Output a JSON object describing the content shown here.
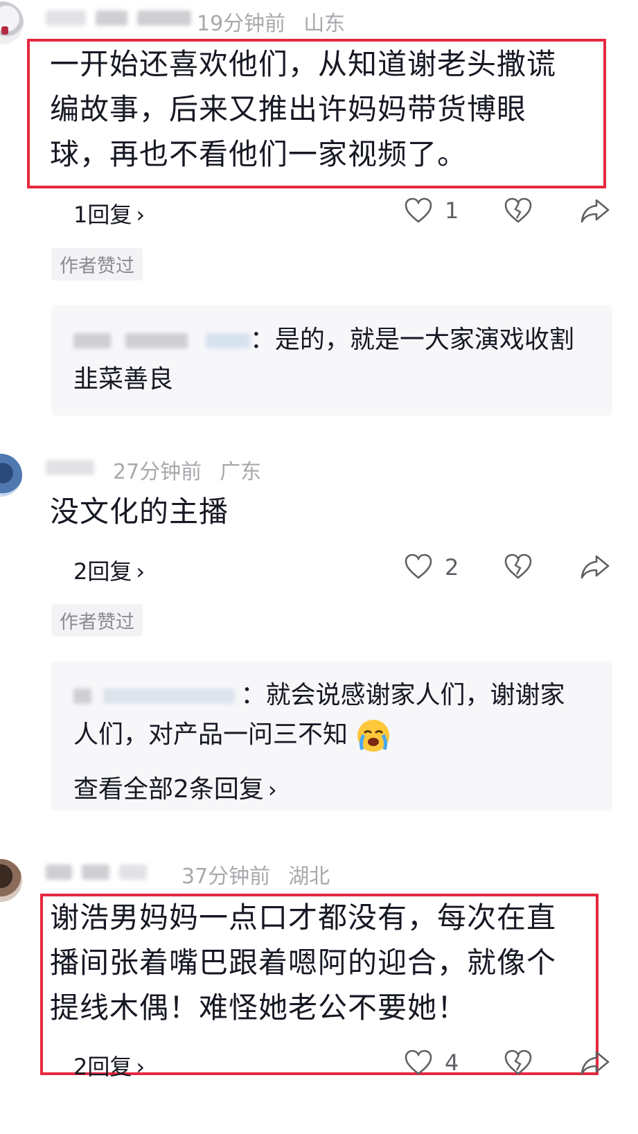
{
  "comments": [
    {
      "time": "19分钟前",
      "location": "山东",
      "text_lines": [
        "一开始还喜欢他们，从知道谢老头撒谎",
        "编故事，后来又推出许妈妈带货博眼",
        "球，再也不看他们一家视频了。"
      ],
      "replies_label": "1回复",
      "likes": "1",
      "author_liked": "作者赞过",
      "reply_text_lines": [
        "：是的，就是一大家演戏收割",
        "韭菜善良"
      ]
    },
    {
      "time": "27分钟前",
      "location": "广东",
      "text_lines": [
        "没文化的主播"
      ],
      "replies_label": "2回复",
      "likes": "2",
      "author_liked": "作者赞过",
      "reply_text_lines": [
        "：就会说感谢家人们，谢谢家",
        "人们，对产品一问三不知"
      ],
      "view_all": "查看全部2条回复"
    },
    {
      "time": "37分钟前",
      "location": "湖北",
      "text_lines": [
        "谢浩男妈妈一点口才都没有，每次在直",
        "播间张着嘴巴跟着嗯阿的迎合，就像个",
        "提线木偶！难怪她老公不要她！"
      ],
      "replies_label": "2回复",
      "likes": "4"
    }
  ],
  "colors": {
    "highlight_border": "#e5283f",
    "meta_gray": "#a8a9ad",
    "text": "#161823"
  },
  "icons": [
    "heart-icon",
    "dislike-icon",
    "share-icon",
    "chevron-right-icon",
    "crying-emoji-icon"
  ]
}
